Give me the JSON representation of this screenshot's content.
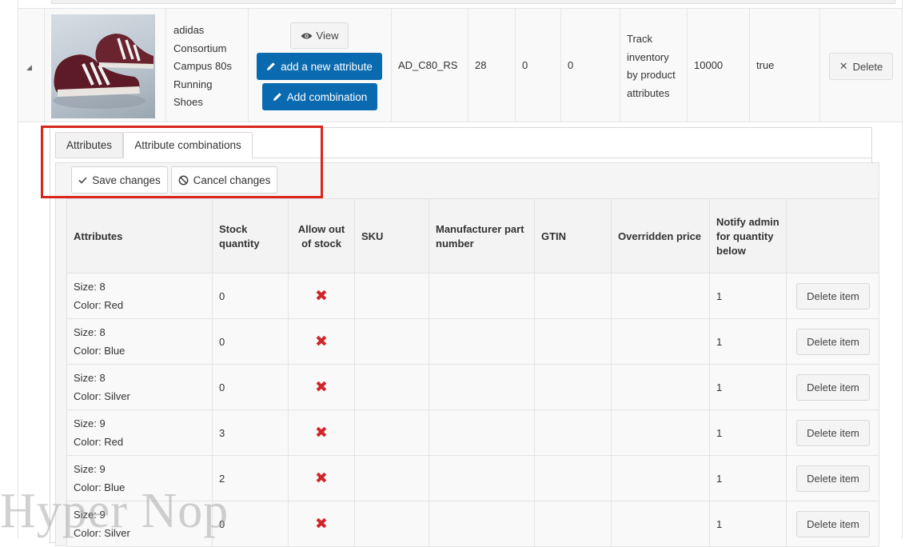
{
  "product": {
    "name_lines": [
      "adidas",
      "Consortium",
      "Campus 80s",
      "Running",
      "Shoes"
    ],
    "view_label": "View",
    "add_attribute_label": "add a new attribute",
    "add_combination_label": "Add combination",
    "sku": "AD_C80_RS",
    "price": "28",
    "col_a": "0",
    "col_b": "0",
    "inventory_lines": [
      "Track",
      "inventory",
      "by product",
      "attributes"
    ],
    "quantity": "10000",
    "published": "true",
    "delete_label": "Delete"
  },
  "tabs": [
    {
      "label": "Attributes",
      "active": false
    },
    {
      "label": "Attribute combinations",
      "active": true
    }
  ],
  "toolbar": {
    "save_label": "Save changes",
    "cancel_label": "Cancel changes"
  },
  "grid": {
    "headers": [
      "Attributes",
      "Stock quantity",
      "Allow out of stock",
      "SKU",
      "Manufacturer part number",
      "GTIN",
      "Overridden price",
      "Notify admin for quantity below",
      ""
    ],
    "rows": [
      {
        "size": "Size: 8",
        "color": "Color: Red",
        "stock": "0",
        "notify": "1",
        "delete_label": "Delete item"
      },
      {
        "size": "Size: 8",
        "color": "Color: Blue",
        "stock": "0",
        "notify": "1",
        "delete_label": "Delete item"
      },
      {
        "size": "Size: 8",
        "color": "Color: Silver",
        "stock": "0",
        "notify": "1",
        "delete_label": "Delete item"
      },
      {
        "size": "Size: 9",
        "color": "Color: Red",
        "stock": "3",
        "notify": "1",
        "delete_label": "Delete item"
      },
      {
        "size": "Size: 9",
        "color": "Color: Blue",
        "stock": "2",
        "notify": "1",
        "delete_label": "Delete item"
      },
      {
        "size": "Size: 9",
        "color": "Color: Silver",
        "stock": "0",
        "notify": "1",
        "delete_label": "Delete item"
      }
    ]
  },
  "watermark": "Hyper Nop",
  "colors": {
    "primary": "#0a6ab0",
    "highlight": "#d9261c",
    "cross": "#d0252b"
  }
}
